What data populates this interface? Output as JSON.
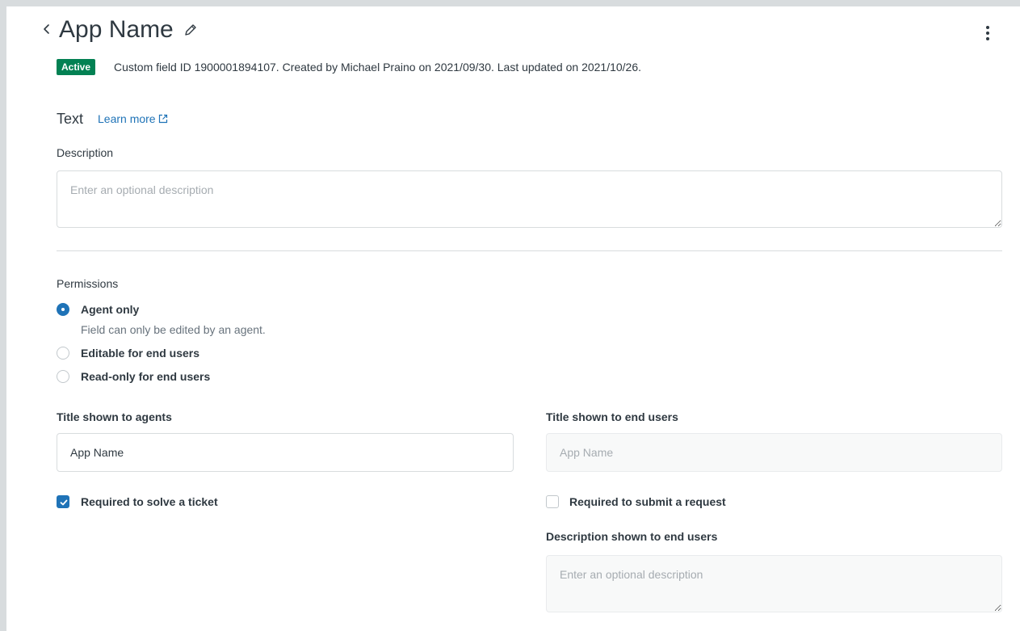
{
  "header": {
    "back_icon": "chevron-left-icon",
    "title": "App Name",
    "edit_icon": "pencil-icon",
    "menu_icon": "kebab-menu-icon"
  },
  "status": {
    "badge": "Active",
    "badge_color": "#038153",
    "meta": "Custom field ID 1900001894107. Created by Michael Praino on 2021/09/30. Last updated on 2021/10/26."
  },
  "field_type": {
    "label": "Text",
    "learn_more": "Learn more",
    "external_icon": "external-link-icon"
  },
  "description": {
    "label": "Description",
    "placeholder": "Enter an optional description",
    "value": ""
  },
  "permissions": {
    "label": "Permissions",
    "selected": "agent-only",
    "options": [
      {
        "label": "Agent only",
        "hint": "Field can only be edited by an agent."
      },
      {
        "label": "Editable for end users"
      },
      {
        "label": "Read-only for end users"
      }
    ]
  },
  "agents": {
    "title_label": "Title shown to agents",
    "title_value": "App Name",
    "required_label": "Required to solve a ticket",
    "required_checked": true
  },
  "end_users": {
    "title_label": "Title shown to end users",
    "title_placeholder": "App Name",
    "required_label": "Required to submit a request",
    "required_checked": false,
    "description_label": "Description shown to end users",
    "description_placeholder": "Enter an optional description"
  },
  "colors": {
    "accent": "#1f73b7",
    "text": "#2f3941",
    "border": "#d8dcde"
  }
}
